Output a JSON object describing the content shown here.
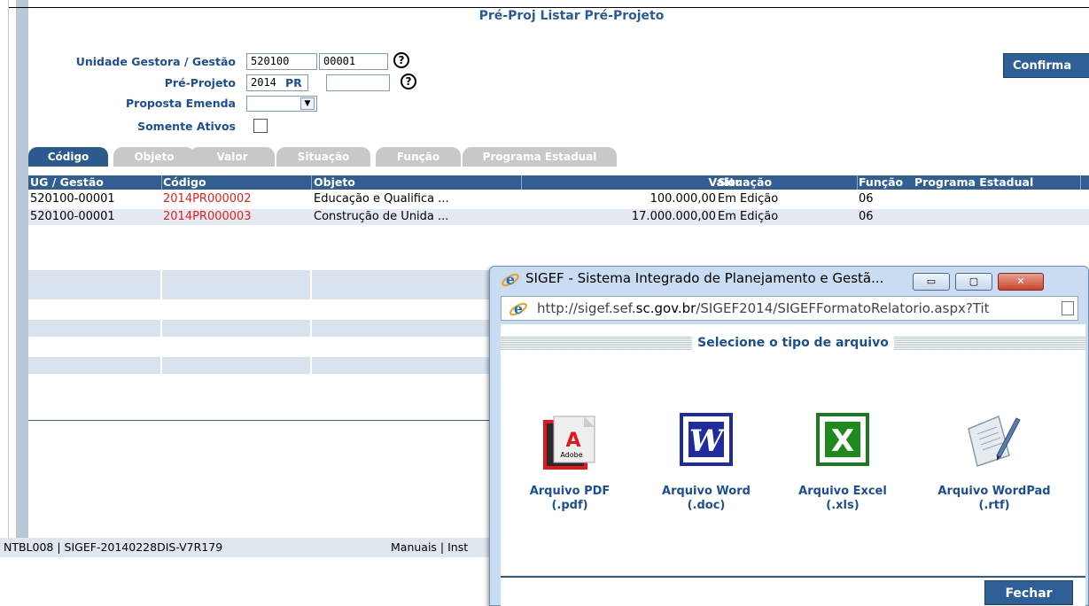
{
  "page": {
    "title": "Pré-Proj Listar Pré-Projeto"
  },
  "form": {
    "unidade_label": "Unidade Gestora / Gestão",
    "unidade_value": "520100",
    "gestao_value": "00001",
    "preprojeto_label": "Pré-Projeto",
    "preprojeto_year": "2014",
    "preprojeto_prefix": "PR",
    "preprojeto_number": "",
    "proposta_label": "Proposta Emenda",
    "proposta_value": "",
    "somente_label": "Somente Ativos",
    "help_glyph": "?",
    "confirm_label": "Confirma"
  },
  "tabs": [
    {
      "label": "Código",
      "active": true
    },
    {
      "label": "Objeto",
      "active": false
    },
    {
      "label": "Valor",
      "active": false
    },
    {
      "label": "Situação",
      "active": false
    },
    {
      "label": "Função",
      "active": false
    },
    {
      "label": "Programa Estadual",
      "active": false
    }
  ],
  "grid": {
    "columns": [
      "UG / Gestão",
      "Código",
      "Objeto",
      "Valor",
      "Situação",
      "Função",
      "Programa Estadual"
    ],
    "rows": [
      {
        "ug": "520100-00001",
        "codigo": "2014PR000002",
        "objeto": "Educação e Qualifica ...",
        "valor": "100.000,00",
        "situacao": "Em Edição",
        "funcao": "06",
        "programa": ""
      },
      {
        "ug": "520100-00001",
        "codigo": "2014PR000003",
        "objeto": "Construção de Unida ...",
        "valor": "17.000.000,00",
        "situacao": "Em Edição",
        "funcao": "06",
        "programa": ""
      }
    ]
  },
  "footer": {
    "left": "NTBL008 |  SIGEF-20140228DIS-V7R179",
    "right": "Manuais | Inst"
  },
  "popup": {
    "title": "SIGEF - Sistema Integrado de Planejamento e Gestã...",
    "url_prefix": "http://sigef.sef.",
    "url_domain": "sc.gov.br",
    "url_suffix": "/SIGEF2014/SIGEFFormatoRelatorio.aspx?Tit",
    "minimize_glyph": "▭",
    "maximize_glyph": "▢",
    "close_glyph": "✕",
    "select_label": "Selecione o tipo de arquivo",
    "pdf_line1": "Arquivo PDF",
    "pdf_line2": "(.pdf)",
    "word_line1": "Arquivo Word",
    "word_line2": "(.doc)",
    "excel_line1": "Arquivo Excel",
    "excel_line2": "(.xls)",
    "wordpad_line1": "Arquivo WordPad",
    "wordpad_line2": "(.rtf)",
    "adobe_text": "Adobe",
    "fechar_label": "Fechar"
  },
  "colors": {
    "accent": "#2e5f96",
    "header": "#325e91",
    "code_red": "#e8201c"
  }
}
